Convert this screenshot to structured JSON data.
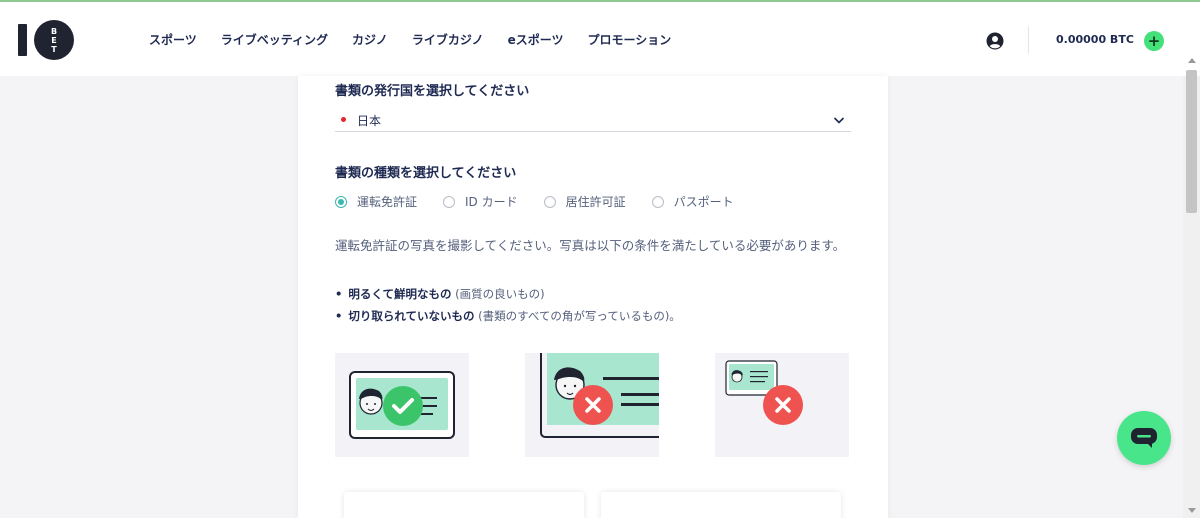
{
  "header": {
    "logo_text": "10BET",
    "nav": [
      {
        "label": "スポーツ"
      },
      {
        "label": "ライブベッティング"
      },
      {
        "label": "カジノ"
      },
      {
        "label": "ライブカジノ"
      },
      {
        "label": "eスポーツ"
      },
      {
        "label": "プロモーション"
      }
    ],
    "balance": "0.00000 BTC",
    "add_label": "+"
  },
  "form": {
    "country_label": "書類の発行国を選択してください",
    "country_value": "日本",
    "doctype_label": "書類の種類を選択してください",
    "doc_types": [
      {
        "label": "運転免許証",
        "selected": true
      },
      {
        "label": "ID カード",
        "selected": false
      },
      {
        "label": "居住許可証",
        "selected": false
      },
      {
        "label": "パスポート",
        "selected": false
      }
    ],
    "instructions": "運転免許証の写真を撮影してください。写真は以下の条件を満たしている必要があります。",
    "requirements": [
      {
        "strong": "明るくて鮮明なもの",
        "note": " (画質の良いもの)"
      },
      {
        "strong": "切り取られていないもの",
        "note": " (書類のすべての角が写っているもの)。"
      }
    ]
  },
  "colors": {
    "accent_green": "#48e58b",
    "check_green": "#3cc46a",
    "error_red": "#ef5350",
    "card_mint": "#a8e6cf",
    "text_navy": "#1f2a52",
    "radio_teal": "#3cb8b0"
  },
  "icons": {
    "user": "user-circle-icon",
    "chevron": "chevron-down-icon",
    "chat": "chat-bubble-icon",
    "check": "checkmark-icon",
    "cross": "cross-icon"
  }
}
